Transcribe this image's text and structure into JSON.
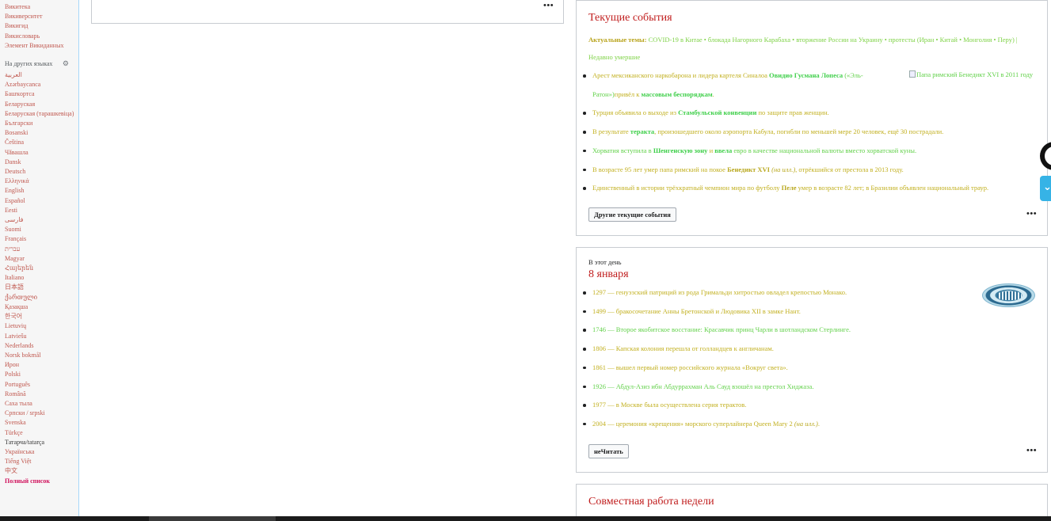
{
  "sidebar": {
    "projects": [
      "Викитека",
      "Викиверситет",
      "Викигид",
      "Викисловарь",
      "Элемент Викиданных"
    ],
    "languages_heading": "На других языках",
    "languages": [
      "العربية",
      "Azərbaycanca",
      "Башҡортса",
      "Беларуская",
      "Беларуская (тарашкевіца)",
      "Български",
      "Bosanski",
      "Čeština",
      "Чӑвашла",
      "Dansk",
      "Deutsch",
      "Ελληνικά",
      "English",
      "Español",
      "Eesti",
      "فارسی",
      "Suomi",
      "Français",
      "עברית",
      "Magyar",
      "Հայերեն",
      "Italiano",
      "日本語",
      "ქართული",
      "Қазақша",
      "한국어",
      "Lietuvių",
      "Latviešu",
      "Nederlands",
      "Norsk bokmål",
      "Ирон",
      "Polski",
      "Português",
      "Română",
      "Саха тыла",
      "Српски / srpski",
      "Svenska",
      "Türkçe",
      "Татарча/tatarça",
      "Українська",
      "Tiếng Việt",
      "中文"
    ],
    "full_list": "Полный список"
  },
  "news": {
    "title": "Текущие события",
    "topics_label": "Актуальные темы:",
    "topics_text": "COVID-19 в Китае • блокада Нагорного Карабаха • вторжение России на Украину • протесты (Иран • Китай • Монголия • Перу) | Недавно умершие",
    "items": [
      {
        "parts": [
          {
            "t": "Арест мексиканского наркобарона и лидера картеля Синалоа ",
            "c": "c-y"
          },
          {
            "t": "Овидио Гусмана Лопеса",
            "c": "c-bold"
          },
          {
            "t": " («Эль-Ратон»)",
            "c": "c-g"
          }
        ]
      },
      {
        "parts": [
          {
            "t": "привёл к ",
            "c": "c-y"
          },
          {
            "t": "массовым беспорядкам",
            "c": "c-bold"
          },
          {
            "t": ".",
            "c": "c-y"
          }
        ]
      },
      {
        "parts": [
          {
            "t": "Турция объявила о выходе из ",
            "c": "c-y"
          },
          {
            "t": "Стамбульской конвенции",
            "c": "c-bold"
          },
          {
            "t": " по защите прав женщин.",
            "c": "c-y"
          }
        ]
      },
      {
        "parts": [
          {
            "t": "В результате ",
            "c": "c-y"
          },
          {
            "t": "теракта",
            "c": "c-bold"
          },
          {
            "t": ", произошедшего около аэропорта Кабула, погибли по меньшей мере 20 человек, ещё 30 пострадали.",
            "c": "c-y"
          }
        ]
      },
      {
        "parts": [
          {
            "t": "Хорватия вступила в ",
            "c": "c-g"
          },
          {
            "t": "Шенгенскую зону",
            "c": "c-bold"
          },
          {
            "t": " и ",
            "c": "c-y"
          },
          {
            "t": "ввела",
            "c": "c-bold"
          },
          {
            "t": " евро в качестве национальной валюты вместо хорватской куны.",
            "c": "c-g"
          }
        ]
      },
      {
        "parts": [
          {
            "t": "В возрасте 95 лет умер папа римский на покое ",
            "c": "c-y"
          },
          {
            "t": "Бенедикт XVI",
            "c": "c-boldy"
          },
          {
            "t": " (на илл.)",
            "c": "c-it"
          },
          {
            "t": ", отрёкшийся от престола в 2013 году.",
            "c": "c-y"
          }
        ]
      },
      {
        "parts": [
          {
            "t": "Единственный в истории трёхкратный чемпион мира по футболу ",
            "c": "c-y"
          },
          {
            "t": "Пеле",
            "c": "c-boldy"
          },
          {
            "t": " умер в возрасте 82 лет; в Бразилии объявлен национальный траур.",
            "c": "c-y"
          }
        ]
      }
    ],
    "image_alt": "Папа римский Бенедикт XVI в 2011 году",
    "more_button": "Другие текущие события",
    "menu_dots": "•••"
  },
  "onday": {
    "subtitle": "В этот день",
    "title": "8 января",
    "items": [
      {
        "parts": [
          {
            "t": "1297 — генуэзский патриций из рода Гримальди хитростью овладел крепостью Монако.",
            "c": "c-y"
          }
        ]
      },
      {
        "parts": [
          {
            "t": "1499 — бракосочетание Анны Бретонской и Людовика XII в замке Нант.",
            "c": "c-y"
          }
        ]
      },
      {
        "parts": [
          {
            "t": "1746 — Второе якобитское восстание: Красавчик принц Чарли в шотландском Стерлинге.",
            "c": "c-g"
          }
        ]
      },
      {
        "parts": [
          {
            "t": "1806 — Капская колония перешла от голландцев к англичанам.",
            "c": "c-y"
          }
        ]
      },
      {
        "parts": [
          {
            "t": "1861 — вышел первый номер российского журнала «Вокруг света».",
            "c": "c-y"
          }
        ]
      },
      {
        "parts": [
          {
            "t": "1926 — Абдул-Азиз ибн Абдуррахман Аль Сауд взошёл на престол Хиджаза.",
            "c": "c-g"
          }
        ]
      },
      {
        "parts": [
          {
            "t": "1977 — в Москве была осуществлена серия терактов.",
            "c": "c-y"
          }
        ]
      },
      {
        "parts": [
          {
            "t": "2004 — церемония «крещения» морского суперлайнера Queen Mary 2 ",
            "c": "c-y"
          },
          {
            "t": "(на илл.)",
            "c": "c-it"
          },
          {
            "t": ".",
            "c": "c-y"
          }
        ]
      }
    ],
    "read_button": "неЧитать",
    "menu_dots": "•••"
  },
  "top_card": {
    "menu_dots": "•••"
  },
  "collab": {
    "title": "Совместная работа недели"
  },
  "colors": {
    "heading": "#c01d1d",
    "link_green": "#62d14a",
    "link_yellow": "#c2b020",
    "sidebar_link": "#c0584f",
    "accent_blue": "#36b3e6"
  }
}
